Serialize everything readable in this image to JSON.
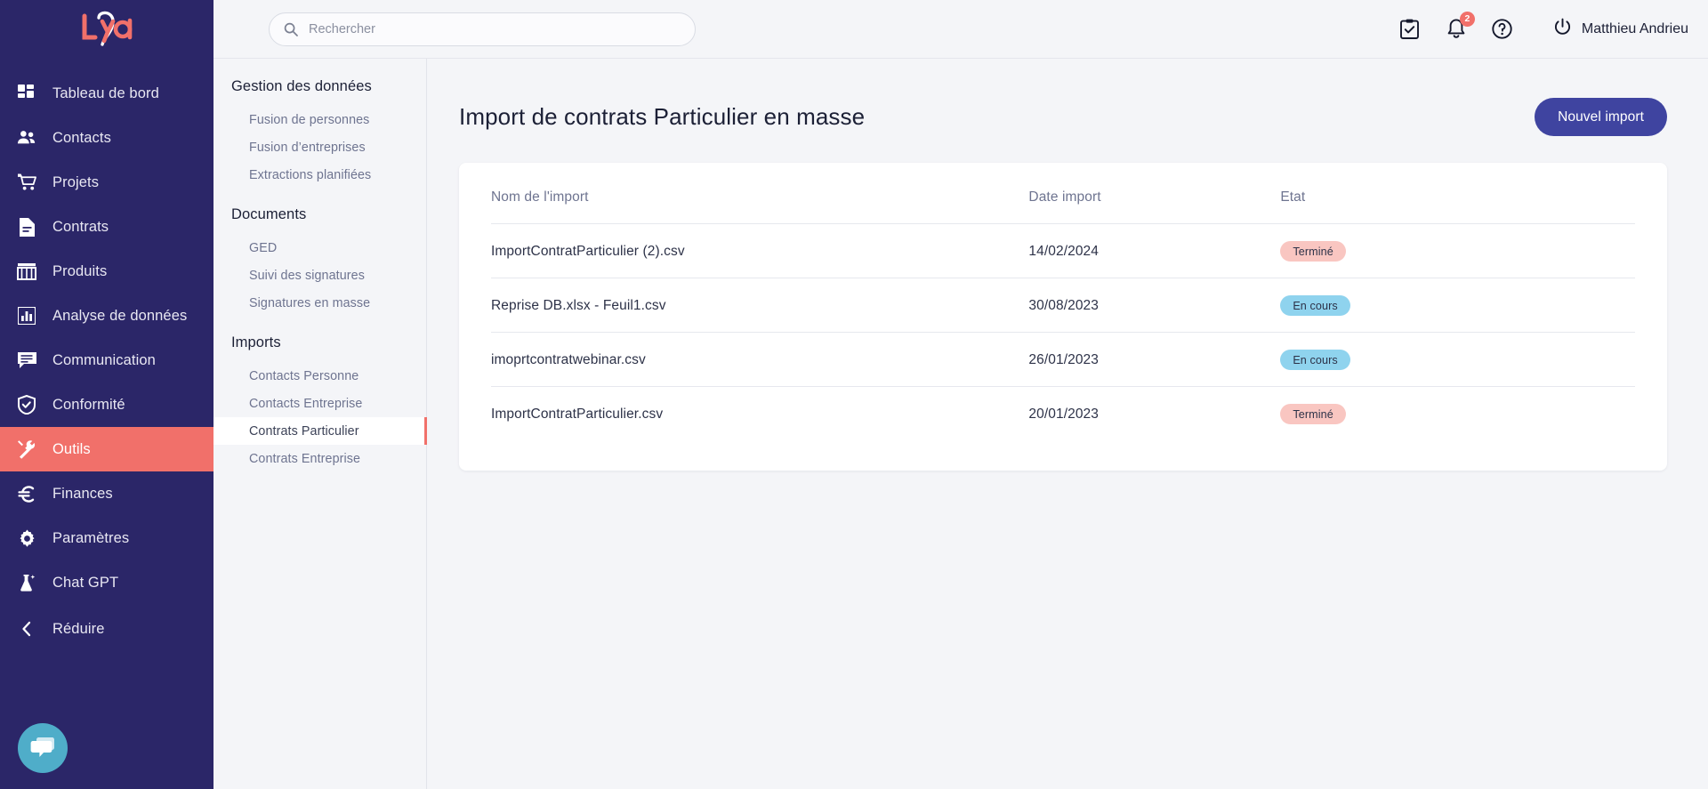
{
  "brand": {
    "name": "Lya",
    "logo_colors": {
      "coral": "#f1706a",
      "white": "#ffffff"
    }
  },
  "theme": {
    "sidebar_bg": "#2b2668",
    "accent_coral": "#f1706a",
    "accent_indigo": "#3f44a0",
    "page_bg": "#f4f5f8",
    "status_done_bg": "#f9c6c1",
    "status_running_bg": "#8fd3ee"
  },
  "sidebar": {
    "items": [
      {
        "label": "Tableau de bord",
        "icon": "dashboard-icon",
        "active": false
      },
      {
        "label": "Contacts",
        "icon": "people-icon",
        "active": false
      },
      {
        "label": "Projets",
        "icon": "cart-icon",
        "active": false
      },
      {
        "label": "Contrats",
        "icon": "document-icon",
        "active": false
      },
      {
        "label": "Produits",
        "icon": "store-icon",
        "active": false
      },
      {
        "label": "Analyse de données",
        "icon": "bar-chart-icon",
        "active": false
      },
      {
        "label": "Communication",
        "icon": "chat-bubble-icon",
        "active": false
      },
      {
        "label": "Conformité",
        "icon": "shield-check-icon",
        "active": false
      },
      {
        "label": "Outils",
        "icon": "tools-icon",
        "active": true
      },
      {
        "label": "Finances",
        "icon": "euro-icon",
        "active": false
      },
      {
        "label": "Paramètres",
        "icon": "gear-icon",
        "active": false
      },
      {
        "label": "Chat GPT",
        "icon": "flask-sparkle-icon",
        "active": false
      }
    ],
    "collapse": {
      "label": "Réduire",
      "icon": "chevron-left-icon"
    },
    "chat_widget": {
      "icon": "chat-support-icon",
      "color": "#4fadc9"
    }
  },
  "topbar": {
    "search": {
      "placeholder": "Rechercher",
      "value": "",
      "icon": "search-icon"
    },
    "tasks": {
      "icon": "clipboard-check-icon"
    },
    "notifications": {
      "icon": "bell-icon",
      "count": "2"
    },
    "help": {
      "icon": "help-circle-icon"
    },
    "user": {
      "name": "Matthieu Andrieu",
      "icon": "power-icon"
    }
  },
  "subnav": {
    "groups": [
      {
        "title": "Gestion des données",
        "items": [
          {
            "label": "Fusion de personnes",
            "active": false
          },
          {
            "label": "Fusion d’entreprises",
            "active": false
          },
          {
            "label": "Extractions planifiées",
            "active": false
          }
        ]
      },
      {
        "title": "Documents",
        "items": [
          {
            "label": "GED",
            "active": false
          },
          {
            "label": "Suivi des signatures",
            "active": false
          },
          {
            "label": "Signatures en masse",
            "active": false
          }
        ]
      },
      {
        "title": "Imports",
        "items": [
          {
            "label": "Contacts Personne",
            "active": false
          },
          {
            "label": "Contacts Entreprise",
            "active": false
          },
          {
            "label": "Contrats Particulier",
            "active": true
          },
          {
            "label": "Contrats Entreprise",
            "active": false
          }
        ]
      }
    ]
  },
  "main": {
    "title": "Import de contrats Particulier en masse",
    "new_import_button": "Nouvel import",
    "table": {
      "columns": [
        "Nom de l'import",
        "Date import",
        "Etat"
      ],
      "rows": [
        {
          "name": "ImportContratParticulier (2).csv",
          "date": "14/02/2024",
          "state": "Terminé",
          "state_kind": "done"
        },
        {
          "name": "Reprise DB.xlsx - Feuil1.csv",
          "date": "30/08/2023",
          "state": "En cours",
          "state_kind": "running"
        },
        {
          "name": "imoprtcontratwebinar.csv",
          "date": "26/01/2023",
          "state": "En cours",
          "state_kind": "running"
        },
        {
          "name": "ImportContratParticulier.csv",
          "date": "20/01/2023",
          "state": "Terminé",
          "state_kind": "done"
        }
      ]
    }
  }
}
